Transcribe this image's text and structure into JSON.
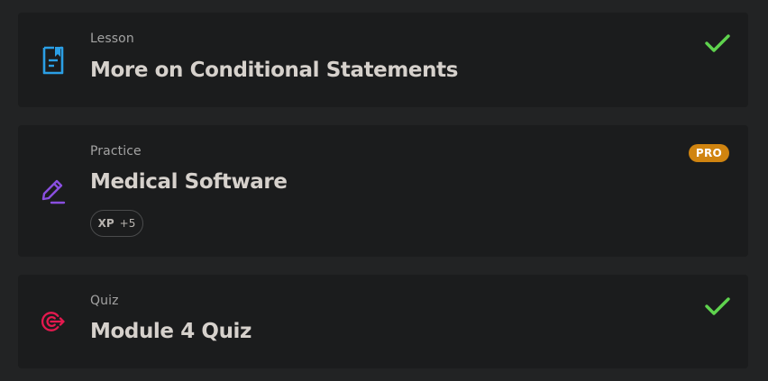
{
  "colors": {
    "background": "#222324",
    "card": "#1b1c1d",
    "lesson_icon": "#2b9fe5",
    "practice_icon": "#8a4fe0",
    "quiz_icon": "#e5194f",
    "check": "#5fd34e",
    "pro_badge": "#d08410"
  },
  "items": [
    {
      "kind": "Lesson",
      "title": "More on Conditional Statements",
      "icon": "document-icon",
      "status": "completed"
    },
    {
      "kind": "Practice",
      "title": "Medical Software",
      "icon": "pencil-icon",
      "badge": "PRO",
      "xp_label": "XP",
      "xp_value": "+5"
    },
    {
      "kind": "Quiz",
      "title": "Module 4 Quiz",
      "icon": "target-icon",
      "status": "completed"
    }
  ]
}
